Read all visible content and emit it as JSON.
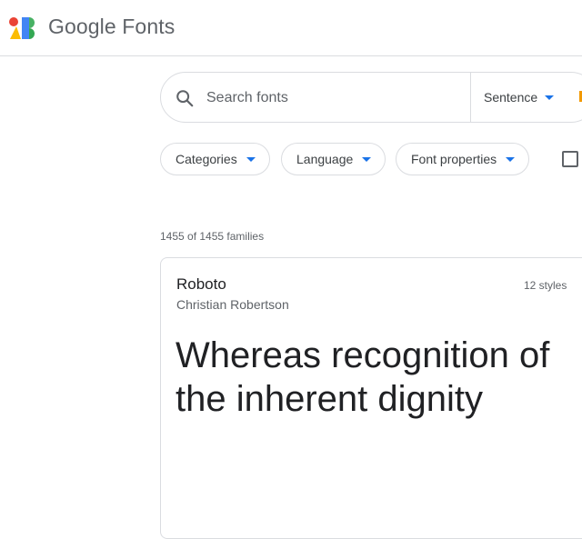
{
  "header": {
    "brand_google": "Google",
    "brand_fonts": "Fonts"
  },
  "search": {
    "placeholder": "Search fonts",
    "value": "",
    "preview_mode": "Sentence"
  },
  "filters": [
    {
      "label": "Categories"
    },
    {
      "label": "Language"
    },
    {
      "label": "Font properties"
    }
  ],
  "results": {
    "count_text": "1455 of 1455 families"
  },
  "font_card": {
    "name": "Roboto",
    "author": "Christian Robertson",
    "styles": "12 styles",
    "preview": "Whereas recognition of the inherent dignity"
  },
  "colors": {
    "accent": "#1a73e8",
    "border": "#dadce0",
    "text": "#202124",
    "muted": "#5f6368"
  },
  "icons": {
    "logo": "google-fonts-logo-icon",
    "search": "search-icon",
    "dropdown": "caret-down-icon"
  }
}
